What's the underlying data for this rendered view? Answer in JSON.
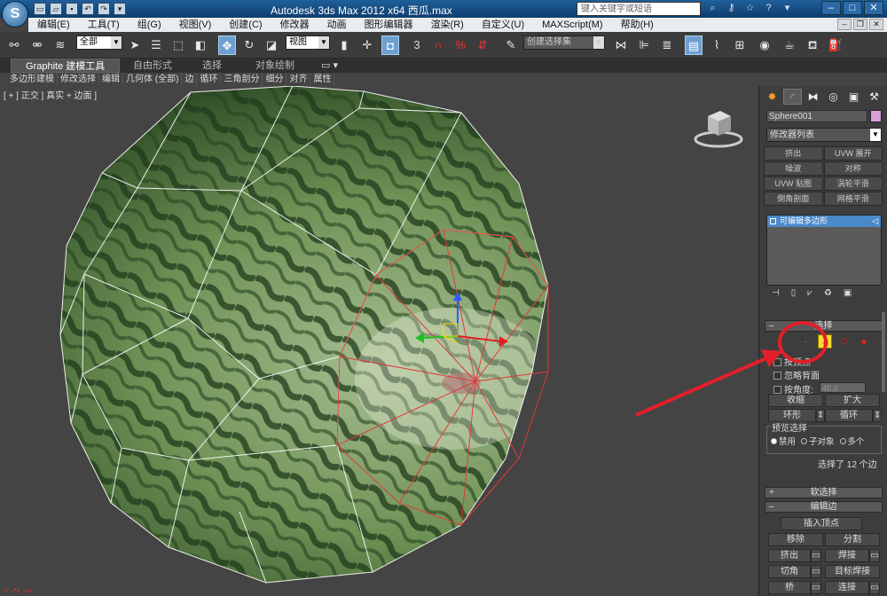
{
  "title_bar": {
    "app_title": "Autodesk 3ds Max  2012 x64    西瓜.max",
    "search_placeholder": "键入关键字或短语",
    "logo_letter": "S"
  },
  "menu": [
    "编辑(E)",
    "工具(T)",
    "组(G)",
    "视图(V)",
    "创建(C)",
    "修改器",
    "动画",
    "图形编辑器",
    "渲染(R)",
    "自定义(U)",
    "MAXScript(M)",
    "帮助(H)"
  ],
  "toolbar": {
    "selection_filter": "全部",
    "reference_coord": "视图",
    "snap_label": "3",
    "percent_label": "%",
    "named_selection": "创建选择集"
  },
  "ribbon": {
    "tabs": [
      "Graphite 建模工具",
      "自由形式",
      "选择",
      "对象绘制"
    ],
    "sub_tabs": [
      "多边形建模",
      "修改选择",
      "编辑",
      "几何体 (全部)",
      "边",
      "循环",
      "三角剖分",
      "细分",
      "对齐",
      "属性"
    ]
  },
  "viewport": {
    "label": "[ + ] 正交 ] 真实 + 边面 ]"
  },
  "command_panel": {
    "object_name": "Sphere001",
    "modifier_list": "修改器列表",
    "modifier_buttons": [
      "挤出",
      "UVW 展开",
      "噪波",
      "对称",
      "UVW 贴图",
      "涡轮平滑",
      "倒角剖面",
      "网格平滑"
    ],
    "stack_item": "可编辑多边形",
    "rollout_selection": "选择",
    "by_vertex": "按顶点",
    "ignore_backfacing": "忽略背面",
    "by_angle": "按角度:",
    "angle_value": "45.0",
    "shrink": "收缩",
    "grow": "扩大",
    "ring": "环形",
    "loop": "循环",
    "preview_selection": "预览选择",
    "preview_options": [
      "禁用",
      "子对象",
      "多个"
    ],
    "selection_count": "选择了 12 个边",
    "rollout_soft": "软选择",
    "rollout_edit_edges": "编辑边",
    "insert_vertex": "插入顶点",
    "remove": "移除",
    "split": "分割",
    "extrude": "挤出",
    "weld": "焊接",
    "chamfer": "切角",
    "target_weld": "目标焊接",
    "bridge": "桥",
    "connect": "连接"
  },
  "colors": {
    "highlight_circle": "#e2202a",
    "stack_selected": "#4a88c8",
    "viewport_bg": "#444444"
  }
}
